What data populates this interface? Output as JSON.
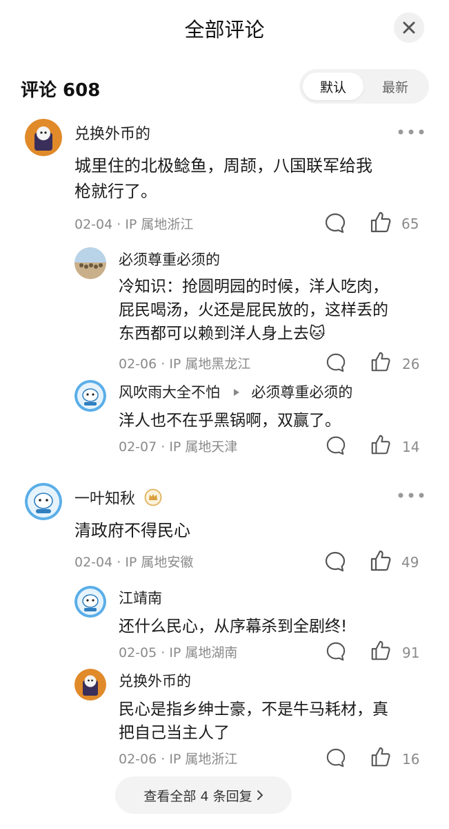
{
  "header": {
    "title": "全部评论"
  },
  "count": {
    "text": "评论 608"
  },
  "sort": {
    "default_label": "默认",
    "latest_label": "最新"
  },
  "comments": [
    {
      "username": "兑换外币的",
      "text_lines": [
        "城里住的北极鲶鱼，周颉，八国联军给我",
        "枪就行了。"
      ],
      "meta": "02-04 · IP 属地浙江",
      "likes": "65",
      "replies": [
        {
          "username": "必须尊重必须的",
          "text_lines": [
            "冷知识：抢圆明园的时候，洋人吃肉，",
            "屁民喝汤，火还是屁民放的，这样丢的",
            "东西都可以赖到洋人身上去"
          ],
          "emoji": "🐱",
          "meta": "02-06 · IP 属地黑龙江",
          "likes": "26"
        },
        {
          "username": "风吹雨大全不怕",
          "reply_to": "必须尊重必须的",
          "text_lines": [
            "洋人也不在乎黑锅啊，双赢了。"
          ],
          "meta": "02-07 · IP 属地天津",
          "likes": "14"
        }
      ]
    },
    {
      "username": "一叶知秋",
      "text_lines": [
        "清政府不得民心"
      ],
      "meta": "02-04 · IP 属地安徽",
      "likes": "49",
      "replies": [
        {
          "username": "江靖南",
          "text_lines": [
            "还什么民心，从序幕杀到全剧终!"
          ],
          "meta": "02-05 · IP 属地湖南",
          "likes": "91"
        },
        {
          "username": "兑换外币的",
          "text_lines": [
            "民心是指乡绅士豪，不是牛马耗材，真",
            "把自己当主人了"
          ],
          "meta": "02-06 · IP 属地浙江",
          "likes": "16"
        }
      ],
      "more_replies_label": "查看全部 4 条回复"
    }
  ]
}
